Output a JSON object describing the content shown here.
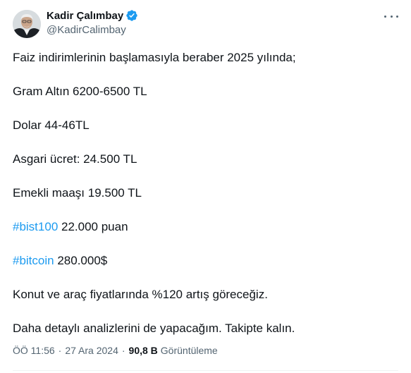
{
  "author": {
    "display_name": "Kadir Çalımbay",
    "handle": "@KadirCalimbay",
    "verified": true
  },
  "tweet": {
    "lines": [
      {
        "hashtag": "",
        "text": "Faiz indirimlerinin başlamasıyla beraber 2025 yılında;"
      },
      {
        "hashtag": "",
        "text": "Gram Altın 6200-6500 TL"
      },
      {
        "hashtag": "",
        "text": "Dolar 44-46TL"
      },
      {
        "hashtag": "",
        "text": "Asgari ücret: 24.500 TL"
      },
      {
        "hashtag": "",
        "text": "Emekli maaşı 19.500 TL"
      },
      {
        "hashtag": "#bist100",
        "text": " 22.000 puan"
      },
      {
        "hashtag": "#bitcoin",
        "text": " 280.000$"
      },
      {
        "hashtag": "",
        "text": "Konut ve araç fiyatlarında %120 artış göreceğiz."
      },
      {
        "hashtag": "",
        "text": "Daha detaylı analizlerini de yapacağım. Takipte kalın."
      }
    ]
  },
  "meta": {
    "time": "ÖÖ 11:56",
    "separator": "·",
    "date": "27 Ara 2024",
    "views_count": "90,8 B",
    "views_label": "Görüntüleme"
  },
  "colors": {
    "accent": "#1d9bf0",
    "text": "#0f1419",
    "secondary": "#536471"
  },
  "icons": {
    "verified": "verified-badge-icon",
    "more": "more-options-icon"
  }
}
